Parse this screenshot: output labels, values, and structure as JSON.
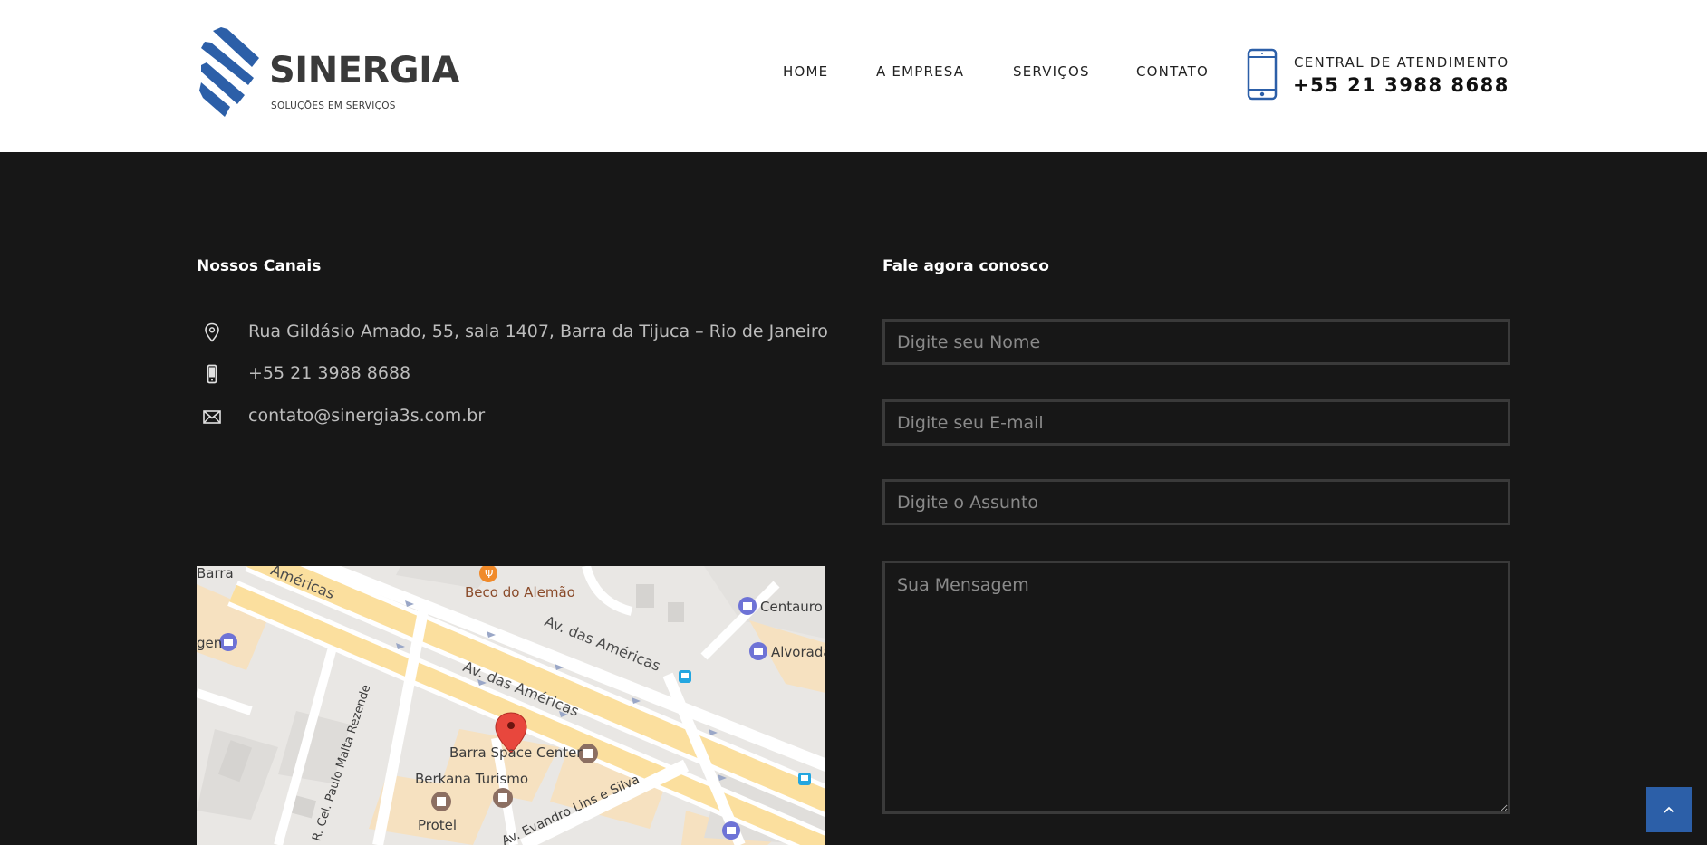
{
  "brand": {
    "name": "SINERGIA",
    "tagline": "SOLUÇÕES EM SERVIÇOS",
    "color": "#2c5fa8"
  },
  "nav": {
    "items": [
      {
        "label": "HOME"
      },
      {
        "label": "A EMPRESA"
      },
      {
        "label": "SERVIÇOS"
      },
      {
        "label": "CONTATO"
      }
    ]
  },
  "central": {
    "label": "CENTRAL DE ATENDIMENTO",
    "number": "+55 21 3988 8688",
    "icon": "smartphone-icon"
  },
  "channels": {
    "title": "Nossos Canais",
    "items": [
      {
        "icon": "map-pin-icon",
        "text": "Rua Gildásio Amado, 55, sala 1407, Barra da Tijuca – Rio de Janeiro"
      },
      {
        "icon": "phone-icon",
        "text": "+55 21 3988 8688"
      },
      {
        "icon": "envelope-icon",
        "text": "contato@sinergia3s.com.br"
      }
    ]
  },
  "map": {
    "labels": {
      "barra": "Barra",
      "americas_top": "Américas",
      "beco": "Beco do Alemão",
      "centauro": "Centauro",
      "alvorada": "Alvorada",
      "gen": "gen",
      "av1": "Av. das Américas",
      "av2": "Av. das Américas",
      "space": "Barra Space Center",
      "berkana": "Berkana Turismo",
      "protel": "Protel",
      "cel": "R. Cel. Paulo Malta Rezende",
      "evandro": "Av. Evandro Lins e Silva"
    }
  },
  "form": {
    "title": "Fale agora conosco",
    "name_placeholder": "Digite seu Nome",
    "email_placeholder": "Digite seu E-mail",
    "subject_placeholder": "Digite o Assunto",
    "message_placeholder": "Sua Mensagem",
    "name_value": "",
    "email_value": "",
    "subject_value": "",
    "message_value": ""
  },
  "scroll_top": {
    "icon": "chevron-up-icon"
  }
}
